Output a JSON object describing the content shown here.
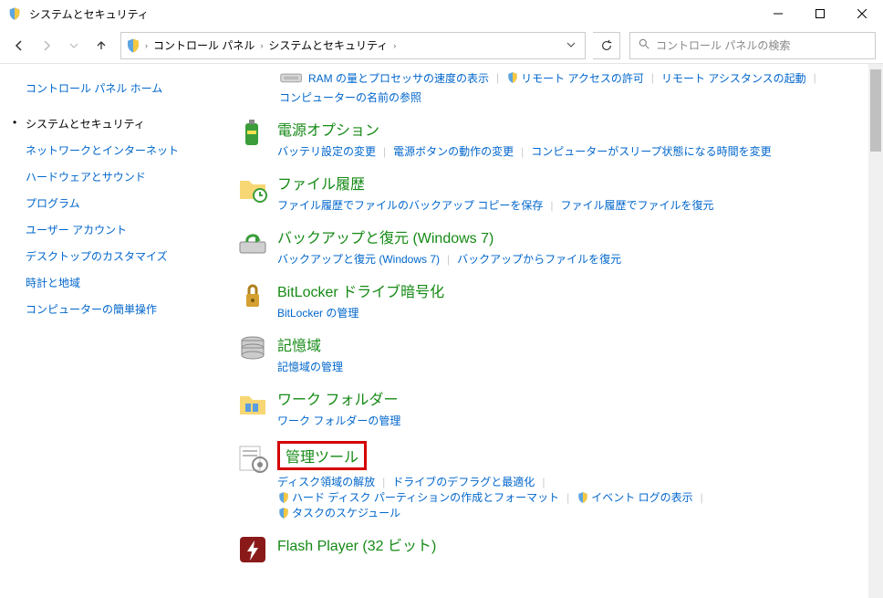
{
  "window": {
    "title": "システムとセキュリティ"
  },
  "breadcrumb": {
    "root": "コントロール パネル",
    "current": "システムとセキュリティ"
  },
  "search": {
    "placeholder": "コントロール パネルの検索"
  },
  "sidebar": {
    "home": "コントロール パネル ホーム",
    "items": [
      "システムとセキュリティ",
      "ネットワークとインターネット",
      "ハードウェアとサウンド",
      "プログラム",
      "ユーザー アカウント",
      "デスクトップのカスタマイズ",
      "時計と地域",
      "コンピューターの簡単操作"
    ]
  },
  "top": {
    "ram": "RAM の量とプロセッサの速度の表示",
    "remote_access": "リモート アクセスの許可",
    "remote_assist": "リモート アシスタンスの起動",
    "computer_name": "コンピューターの名前の参照"
  },
  "cats": {
    "power": {
      "title": "電源オプション",
      "battery": "バッテリ設定の変更",
      "button": "電源ボタンの動作の変更",
      "sleep": "コンピューターがスリープ状態になる時間を変更"
    },
    "filehist": {
      "title": "ファイル履歴",
      "backup": "ファイル履歴でファイルのバックアップ コピーを保存",
      "restore": "ファイル履歴でファイルを復元"
    },
    "backup": {
      "title": "バックアップと復元 (Windows 7)",
      "link1": "バックアップと復元 (Windows 7)",
      "link2": "バックアップからファイルを復元"
    },
    "bitlocker": {
      "title": "BitLocker ドライブ暗号化",
      "manage": "BitLocker の管理"
    },
    "storage": {
      "title": "記憶域",
      "manage": "記憶域の管理"
    },
    "workfolder": {
      "title": "ワーク フォルダー",
      "manage": "ワーク フォルダーの管理"
    },
    "admintools": {
      "title": "管理ツール",
      "disk": "ディスク領域の解放",
      "defrag": "ドライブのデフラグと最適化",
      "partition": "ハード ディスク パーティションの作成とフォーマット",
      "eventlog": "イベント ログの表示",
      "task": "タスクのスケジュール"
    },
    "flash": {
      "title": "Flash Player (32 ビット)"
    }
  }
}
